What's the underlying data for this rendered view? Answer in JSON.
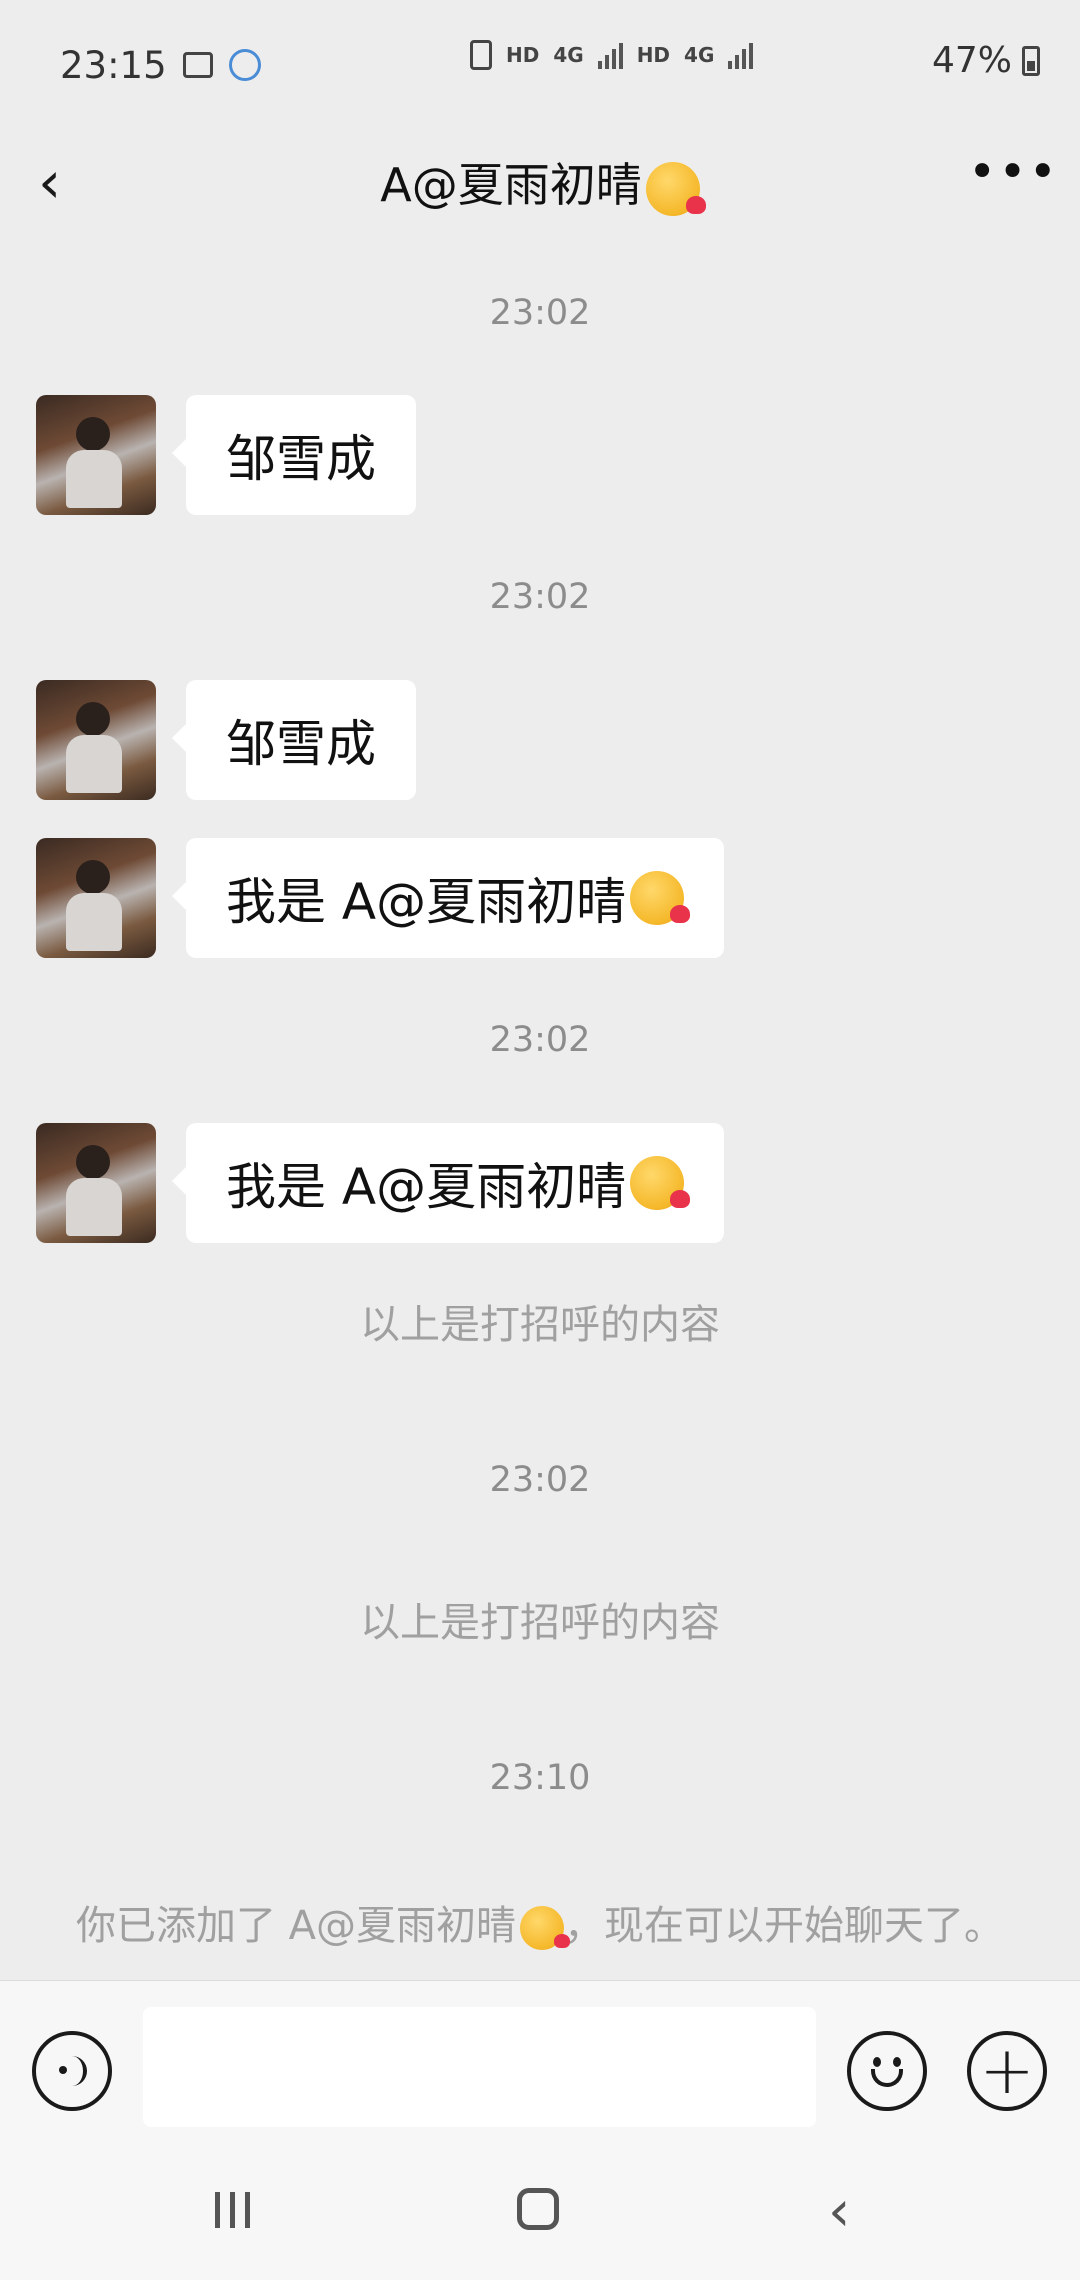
{
  "status_bar": {
    "time": "23:15",
    "network_1": "HD",
    "network_1_gen": "4G",
    "network_2": "HD",
    "network_2_gen": "4G",
    "battery": "47%"
  },
  "header": {
    "title": "A@夏雨初晴"
  },
  "messages": [
    {
      "type": "time",
      "text": "23:02"
    },
    {
      "type": "received",
      "text": "邹雪成"
    },
    {
      "type": "time",
      "text": "23:02"
    },
    {
      "type": "received",
      "text": "邹雪成"
    },
    {
      "type": "received",
      "text": "我是 A@夏雨初晴"
    },
    {
      "type": "time",
      "text": "23:02"
    },
    {
      "type": "received",
      "text": "我是 A@夏雨初晴"
    },
    {
      "type": "system",
      "text": "以上是打招呼的内容"
    },
    {
      "type": "time",
      "text": "23:02"
    },
    {
      "type": "system",
      "text": "以上是打招呼的内容"
    },
    {
      "type": "time",
      "text": "23:10"
    },
    {
      "type": "system",
      "text_before": "你已添加了 A@夏雨初晴",
      "text_after": "，现在可以开始聊天了。"
    }
  ],
  "input": {
    "placeholder": ""
  },
  "icons": {
    "back": "back-chevron-icon",
    "more": "more-dots-icon",
    "voice": "voice-icon",
    "emoji": "emoji-icon",
    "plus": "plus-icon",
    "kiss_emoji": "kissing-face-emoji"
  },
  "colors": {
    "background": "#ededed",
    "bubble": "#ffffff",
    "timestamp": "#8c8c8c",
    "system": "#a0a0a0"
  }
}
